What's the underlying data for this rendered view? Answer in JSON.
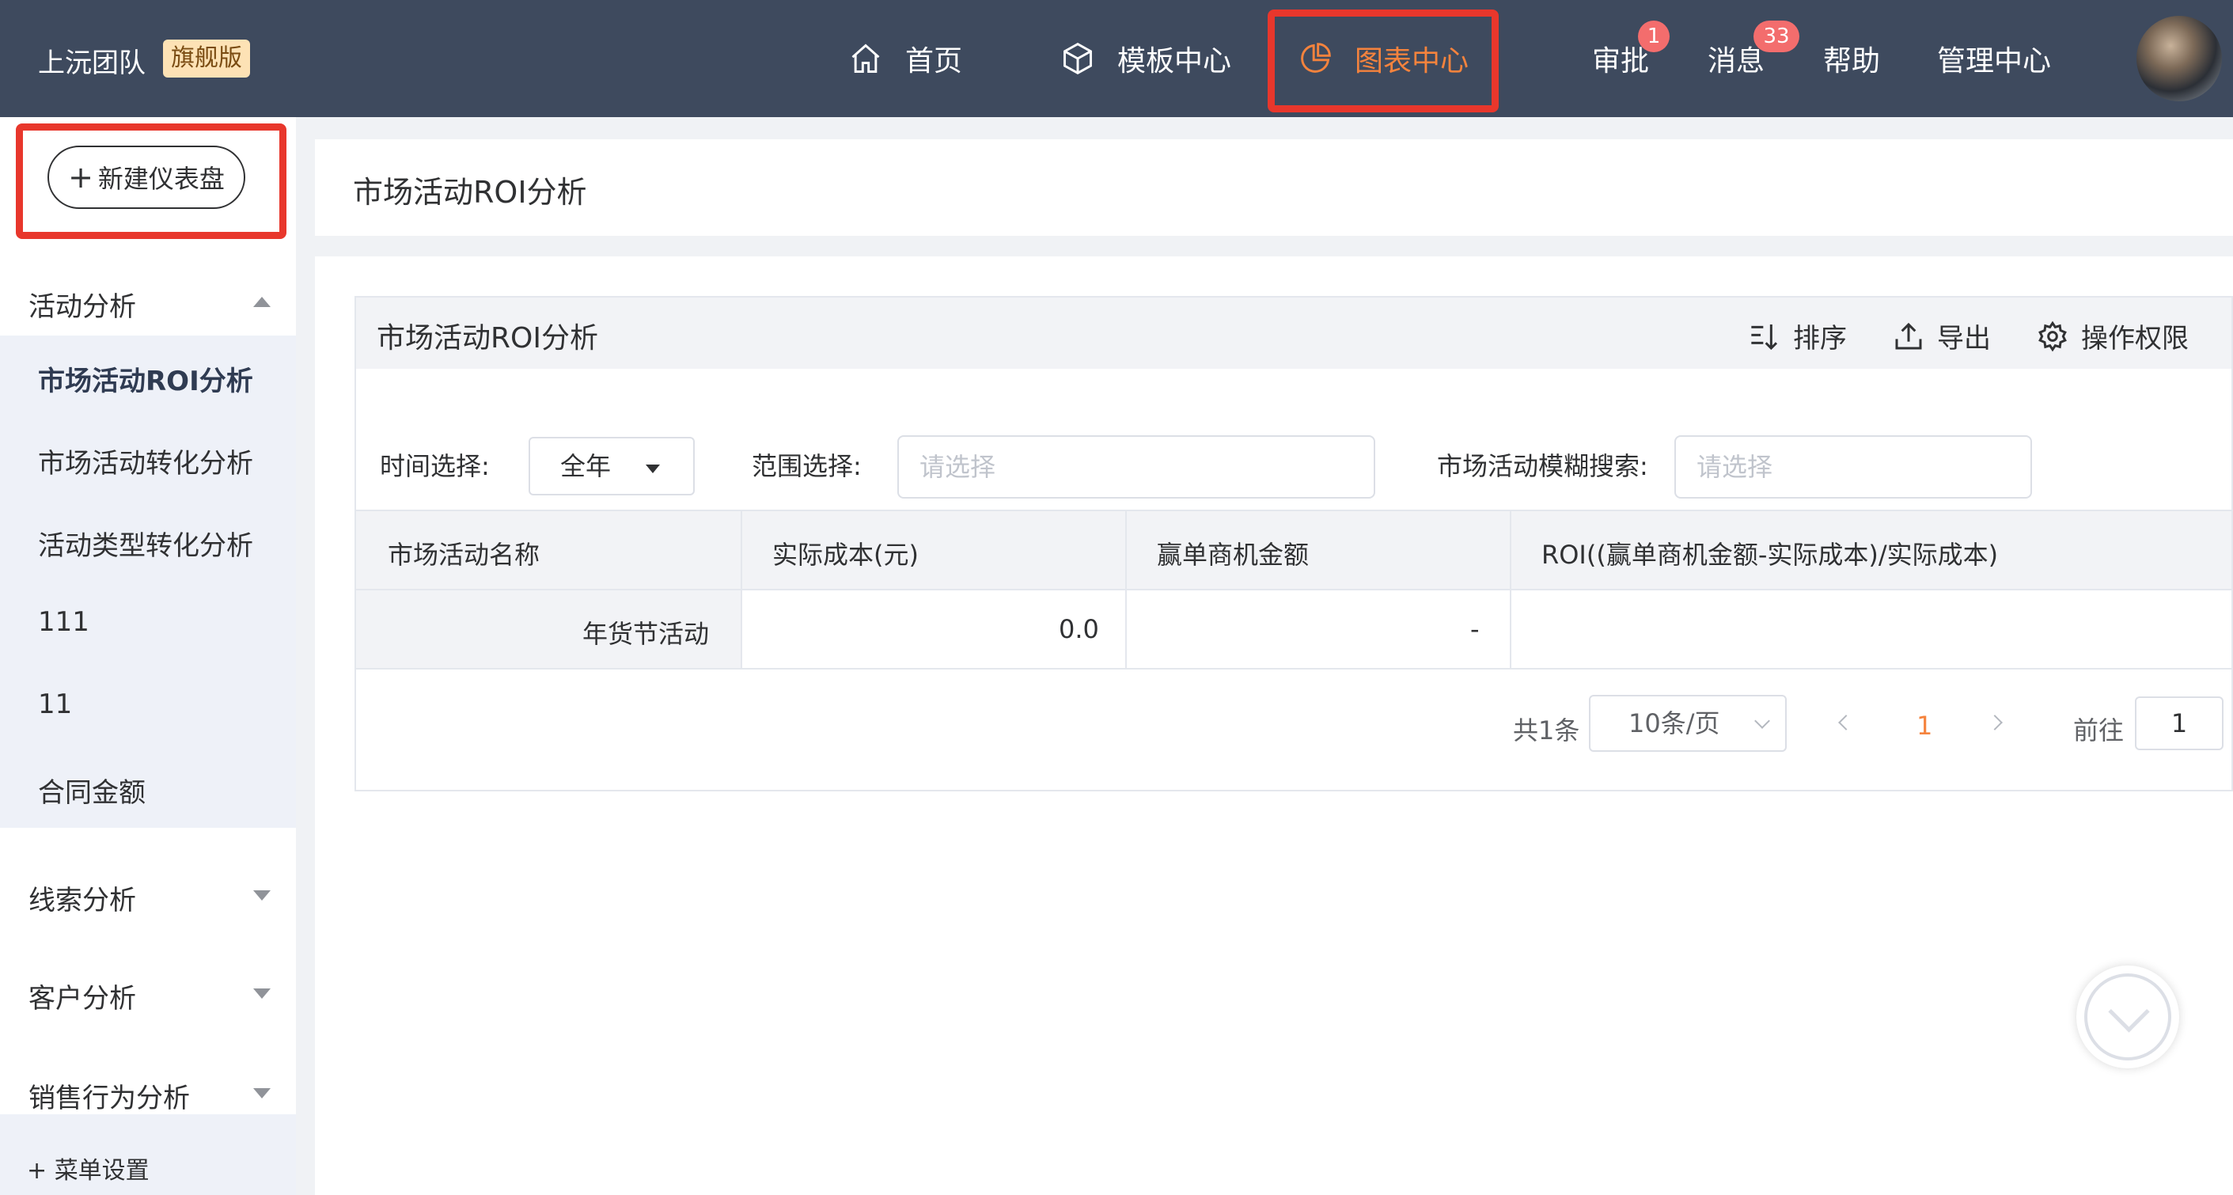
{
  "topnav": {
    "team": "上沅团队",
    "edition": "旗舰版",
    "items": [
      {
        "label": "首页",
        "icon": "home-icon"
      },
      {
        "label": "模板中心",
        "icon": "cube-icon"
      },
      {
        "label": "图表中心",
        "icon": "pie-chart-icon",
        "active": true
      }
    ],
    "approve": "审批",
    "approve_badge": "1",
    "messages": "消息",
    "messages_badge": "33",
    "help": "帮助",
    "admin": "管理中心"
  },
  "sidebar": {
    "new_dashboard": "新建仪表盘",
    "groups": {
      "activity": "活动分析",
      "leads": "线索分析",
      "customer": "客户分析",
      "sales": "销售行为分析"
    },
    "sub_items": [
      "市场活动ROI分析",
      "市场活动转化分析",
      "活动类型转化分析",
      "111",
      "11",
      "合同金额"
    ],
    "settings": "菜单设置"
  },
  "page": {
    "title": "市场活动ROI分析"
  },
  "panel": {
    "title": "市场活动ROI分析",
    "sort": "排序",
    "export": "导出",
    "permission": "操作权限"
  },
  "filters": {
    "time_label": "时间选择:",
    "time_value": "全年",
    "range_label": "范围选择:",
    "range_placeholder": "请选择",
    "search_label": "市场活动模糊搜索:",
    "search_placeholder": "请选择"
  },
  "table": {
    "headers": [
      "市场活动名称",
      "实际成本(元)",
      "赢单商机金额",
      "ROI((赢单商机金额-实际成本)/实际成本)"
    ],
    "rows": [
      [
        "年货节活动",
        "0.0",
        "-",
        ""
      ]
    ]
  },
  "pagination": {
    "total": "共1条",
    "page_size": "10条/页",
    "current": "1",
    "goto_label": "前往",
    "goto_value": "1"
  }
}
